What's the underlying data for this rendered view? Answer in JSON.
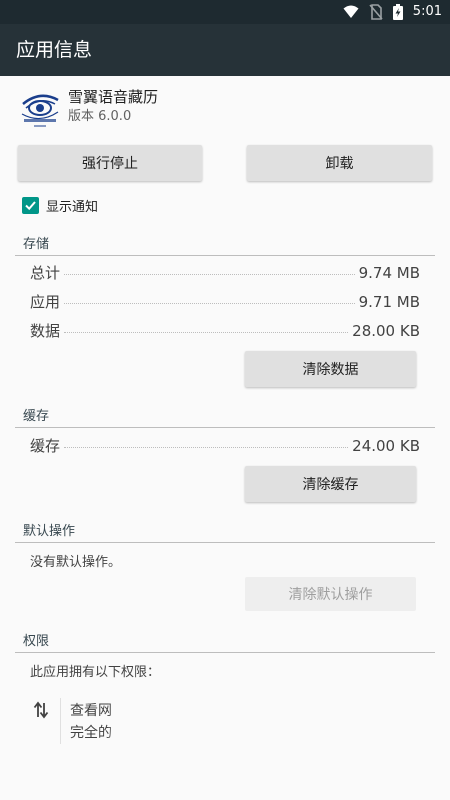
{
  "status_bar": {
    "time": "5:01"
  },
  "app_bar": {
    "title": "应用信息"
  },
  "app": {
    "name": "雪翼语音藏历",
    "version": "版本 6.0.0"
  },
  "buttons": {
    "force_stop": "强行停止",
    "uninstall": "卸载"
  },
  "notifications": {
    "label": "显示通知",
    "checked": true
  },
  "storage": {
    "title": "存储",
    "rows": [
      {
        "label": "总计",
        "value": "9.74 MB"
      },
      {
        "label": "应用",
        "value": "9.71 MB"
      },
      {
        "label": "数据",
        "value": "28.00 KB"
      }
    ],
    "clear_data": "清除数据"
  },
  "cache": {
    "title": "缓存",
    "row": {
      "label": "缓存",
      "value": "24.00 KB"
    },
    "clear_cache": "清除缓存"
  },
  "defaults": {
    "title": "默认操作",
    "none_text": "没有默认操作。",
    "clear_defaults": "清除默认操作"
  },
  "permissions": {
    "title": "权限",
    "intro": "此应用拥有以下权限：",
    "item_line1": "查看网",
    "item_line2": "完全的"
  },
  "colors": {
    "status_bar": "#1e2a30",
    "app_bar": "#263238",
    "accent": "#009688"
  }
}
